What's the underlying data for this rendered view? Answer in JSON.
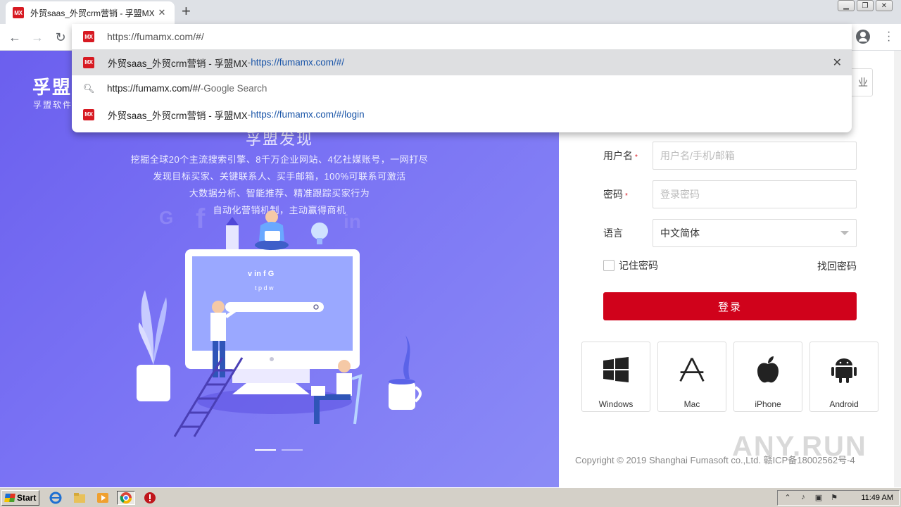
{
  "browser": {
    "tab_title": "外贸saas_外贸crm营销 - 孚盟MX",
    "favicon_text": "MX",
    "address": "https://fumamx.com/#/",
    "new_tab": "+",
    "suggestions": [
      {
        "title": "外贸saas_外贸crm营销 - 孚盟MX",
        "sep": " - ",
        "url": "https://fumamx.com/#/",
        "url_suffix": "",
        "icon": "site-favicon",
        "selected": true
      },
      {
        "title": "https://fumamx.com/#/",
        "sep": " - ",
        "url": "",
        "url_suffix": "Google Search",
        "icon": "search-icon",
        "selected": false
      },
      {
        "title": "外贸saas_外贸crm营销 - 孚盟MX",
        "sep": " - ",
        "url": "https://fumamx.com/#",
        "url_suffix": "/login",
        "icon": "site-favicon",
        "selected": false
      }
    ]
  },
  "hero": {
    "brand": "孚盟",
    "brand_sub": "孚盟软件",
    "title": "孚盟发现",
    "lines": [
      "挖掘全球20个主流搜索引擎、8千万企业网站、4亿社媒账号，一网打尽",
      "发现目标买家、关键联系人、买手邮箱，100%可联系可激活",
      "大数据分析、智能推荐、精准跟踪买家行为",
      "自动化营销机制，主动赢得商机"
    ]
  },
  "login": {
    "corner_text": "业",
    "username_label": "用户名",
    "username_placeholder": "用户名/手机/邮箱",
    "password_label": "密码",
    "password_placeholder": "登录密码",
    "language_label": "语言",
    "language_value": "中文简体",
    "required_mark": "*",
    "remember": "记住密码",
    "forgot": "找回密码",
    "submit": "登录",
    "downloads": [
      "Windows",
      "Mac",
      "iPhone",
      "Android"
    ],
    "copyright": "Copyright © 2019 Shanghai Fumasoft co.,Ltd.  赣ICP备18002562号-4"
  },
  "watermark": "ANY.RUN",
  "taskbar": {
    "start": "Start",
    "clock": "11:49 AM"
  },
  "colors": {
    "brand_red": "#d0021b",
    "hero_start": "#6b5fee",
    "hero_end": "#8b8bf6",
    "link_blue": "#1a55a8"
  }
}
